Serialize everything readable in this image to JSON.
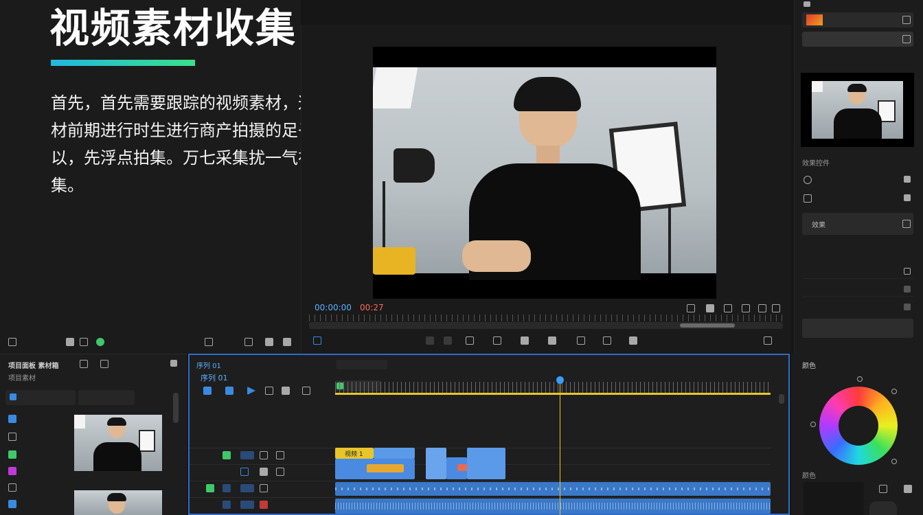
{
  "headline": {
    "title": "视频素材收集",
    "body": "首先，首先需要跟踪的视频素材，这些素材前期进行时生进行商产拍摄的足子可以，先浮点拍集。万七采集扰一气视频收集。"
  },
  "monitor": {
    "timecode_current": "00:00:00",
    "timecode_duration": "00:27"
  },
  "props": {
    "effect_label": "效果",
    "section_effects": "效果控件",
    "section_color": "颜色"
  },
  "media": {
    "header": "项目面板 素材箱",
    "subheader": "项目素材"
  },
  "timeline": {
    "tab_label": "序列 01",
    "sequence_name": "序列 01",
    "clip_label": "视频 1"
  },
  "color": {
    "panel_title": "颜色",
    "colors": {
      "accent": "#2f6cc8",
      "playhead": "#e8c62a"
    }
  }
}
